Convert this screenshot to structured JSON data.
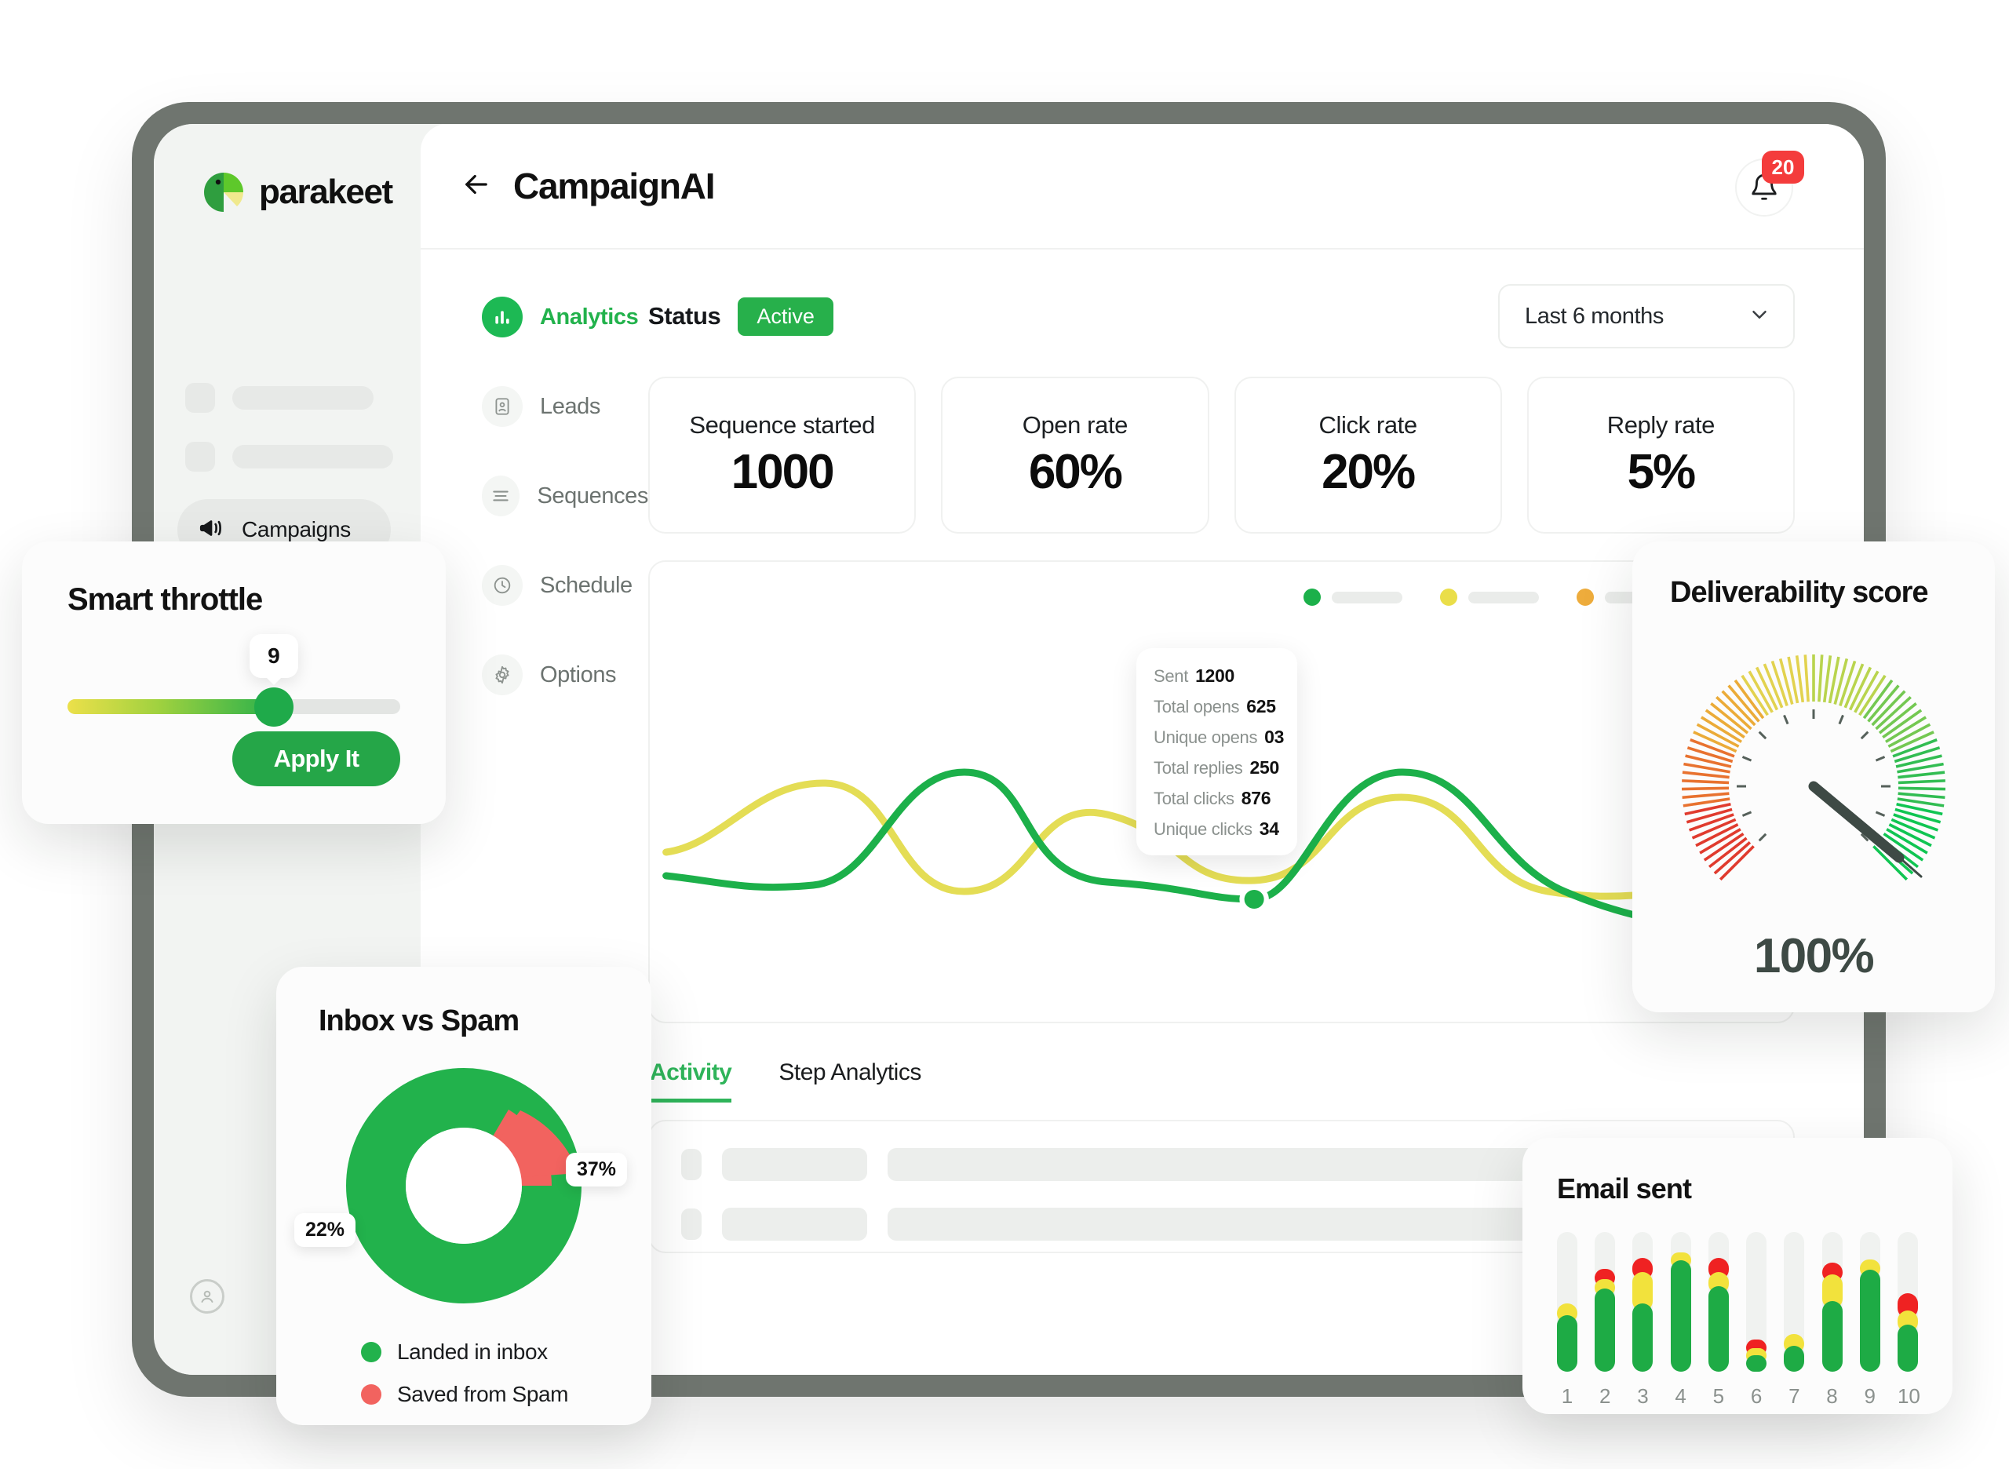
{
  "brand": {
    "name": "parakeet"
  },
  "rail": {
    "active_item": {
      "label": "Campaigns",
      "icon": "megaphone-icon"
    }
  },
  "topbar": {
    "back_icon": "arrow-left-icon",
    "title": "CampaignAI",
    "bell_icon": "bell-icon",
    "notification_count": "20"
  },
  "subnav": {
    "items": [
      {
        "label": "Analytics",
        "icon": "bar-chart-icon",
        "active": true
      },
      {
        "label": "Leads",
        "icon": "contact-card-icon",
        "active": false
      },
      {
        "label": "Sequences",
        "icon": "list-lines-icon",
        "active": false
      },
      {
        "label": "Schedule",
        "icon": "clock-icon",
        "active": false
      },
      {
        "label": "Options",
        "icon": "gear-icon",
        "active": false
      }
    ]
  },
  "status": {
    "label": "Status",
    "badge": "Active",
    "badge_color": "#27b04b"
  },
  "date_range": {
    "value": "Last 6 months",
    "chevron_icon": "chevron-down-icon"
  },
  "stats": [
    {
      "label": "Sequence started",
      "value": "1000"
    },
    {
      "label": "Open rate",
      "value": "60%"
    },
    {
      "label": "Click rate",
      "value": "20%"
    },
    {
      "label": "Reply rate",
      "value": "5%"
    }
  ],
  "chart_legend_dots": [
    "#1cb04a",
    "#eade49",
    "#eeac3c"
  ],
  "tooltip": {
    "rows": [
      {
        "key": "Sent",
        "value": "1200"
      },
      {
        "key": "Total opens",
        "value": "625"
      },
      {
        "key": "Unique opens",
        "value": "03"
      },
      {
        "key": "Total replies",
        "value": "250"
      },
      {
        "key": "Total clicks",
        "value": "876"
      },
      {
        "key": "Unique clicks",
        "value": "34"
      }
    ]
  },
  "tabs": [
    {
      "label": "Activity",
      "active": true
    },
    {
      "label": "Step Analytics",
      "active": false
    }
  ],
  "smart_throttle": {
    "title": "Smart throttle",
    "value": "9",
    "apply_label": "Apply It"
  },
  "inbox_vs_spam": {
    "title": "Inbox vs Spam",
    "labels": [
      {
        "text": "37%"
      },
      {
        "text": "22%"
      }
    ],
    "legend": [
      {
        "label": "Landed in inbox",
        "color": "#22b24c"
      },
      {
        "label": "Saved from Spam",
        "color": "#f2635f"
      }
    ]
  },
  "deliverability": {
    "title": "Deliverability score",
    "value": "100%"
  },
  "email_sent": {
    "title": "Email sent"
  },
  "chart_data": [
    {
      "type": "line",
      "title": "",
      "x": [
        0,
        1,
        2,
        3,
        4,
        5,
        6,
        7,
        8,
        9,
        10
      ],
      "series": [
        {
          "name": "green",
          "color": "#1cb04a",
          "values": [
            34,
            22,
            32,
            60,
            44,
            30,
            30,
            58,
            44,
            30,
            12
          ]
        },
        {
          "name": "yellow",
          "color": "#e4dd55",
          "values": [
            42,
            52,
            62,
            42,
            36,
            34,
            44,
            58,
            52,
            40,
            62
          ]
        }
      ],
      "ylabel": "",
      "xlabel": "",
      "grid": false,
      "legend_position": "top-right",
      "annotation": {
        "type": "tooltip",
        "at_x": 5,
        "rows": {
          "Sent": 1200,
          "Total opens": 625,
          "Unique opens": 3,
          "Total replies": 250,
          "Total clicks": 876,
          "Unique clicks": 34
        }
      }
    },
    {
      "type": "pie",
      "title": "Inbox vs Spam",
      "categories": [
        "Landed in inbox",
        "Saved from Spam"
      ],
      "values": [
        78,
        22
      ],
      "labels": [
        "22%",
        "37%"
      ],
      "colors": [
        "#22b24c",
        "#f2635f"
      ],
      "legend_position": "bottom",
      "donut": true
    },
    {
      "type": "bar",
      "title": "Deliverability score",
      "categories": [
        "score"
      ],
      "values": [
        100
      ],
      "ylim": [
        0,
        100
      ],
      "display_value": "100%"
    },
    {
      "type": "bar",
      "title": "Email sent",
      "categories": [
        "1",
        "2",
        "3",
        "4",
        "5",
        "6",
        "7",
        "8",
        "9",
        "10"
      ],
      "series": [
        {
          "name": "green",
          "color": "#1eab45",
          "values": [
            48,
            70,
            58,
            94,
            72,
            14,
            22,
            60,
            86,
            40
          ]
        },
        {
          "name": "yellow",
          "color": "#f2e23c",
          "values": [
            10,
            8,
            26,
            7,
            12,
            6,
            10,
            22,
            9,
            12
          ]
        },
        {
          "name": "red",
          "color": "#ef2222",
          "values": [
            0,
            9,
            12,
            0,
            12,
            7,
            0,
            10,
            0,
            14
          ]
        }
      ],
      "track_max": 118,
      "ylabel": "",
      "xlabel": "",
      "grid": false,
      "stacked": true
    }
  ]
}
